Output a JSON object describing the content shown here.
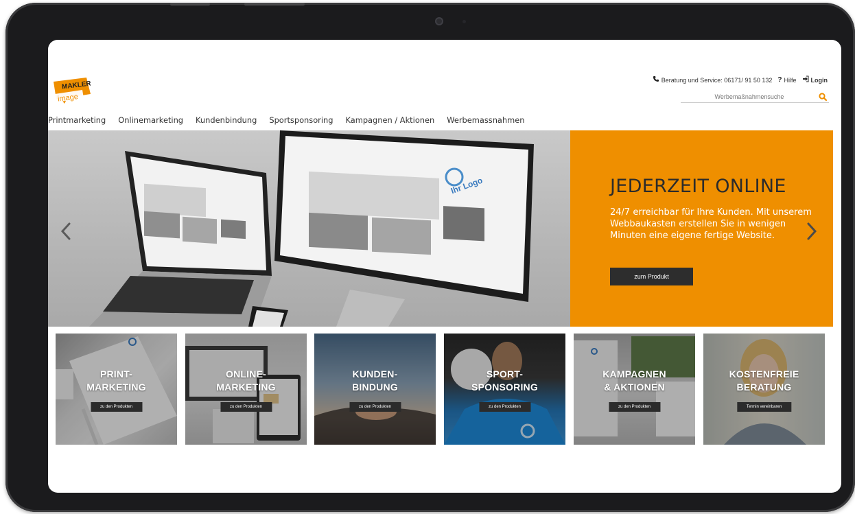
{
  "header": {
    "logo_text_top": "MAKLER",
    "logo_text_bottom": "image",
    "service_label": "Beratung und Service: 06171/ 91 50 132",
    "help_label": "Hilfe",
    "login_label": "Login",
    "search_placeholder": "Werbemaßnahmensuche"
  },
  "nav": {
    "items": [
      {
        "label": "Printmarketing"
      },
      {
        "label": "Onlinemarketing"
      },
      {
        "label": "Kundenbindung"
      },
      {
        "label": "Sportsponsoring"
      },
      {
        "label": "Kampagnen / Aktionen"
      },
      {
        "label": "Werbemassnahmen"
      }
    ]
  },
  "hero": {
    "title": "JEDERZEIT ONLINE",
    "text": "24/7 erreichbar für Ihre Kunden. Mit unserem Webbaukasten erstellen Sie in wenigen Minuten eine eigene fertige Website.",
    "button_label": "zum Produkt",
    "panel_color": "#ef8f00",
    "screen_logo_text": "Ihr Logo"
  },
  "tiles": [
    {
      "line1": "PRINT-",
      "line2": "MARKETING",
      "button": "zu den Produkten"
    },
    {
      "line1": "ONLINE-",
      "line2": "MARKETING",
      "button": "zu den Produkten"
    },
    {
      "line1": "KUNDEN-",
      "line2": "BINDUNG",
      "button": "zu den Produkten"
    },
    {
      "line1": "SPORT-",
      "line2": "SPONSORING",
      "button": "zu den Produkten"
    },
    {
      "line1": "KAMPAGNEN",
      "line2": "& AKTIONEN",
      "button": "zu den Produkten"
    },
    {
      "line1": "KOSTENFREIE",
      "line2": "BERATUNG",
      "button": "Termin vereinbaren"
    }
  ],
  "colors": {
    "accent": "#ef8f00",
    "dark": "#2d2d2d"
  }
}
